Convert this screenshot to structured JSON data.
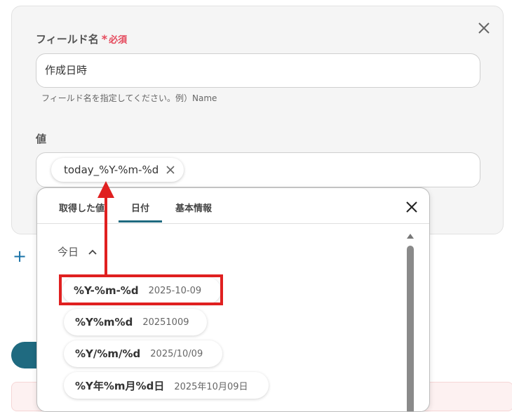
{
  "form": {
    "field_label": "フィールド名",
    "required_star": "*",
    "required_text": "必須",
    "field_value": "作成日時",
    "hint": "フィールド名を指定してください。例）Name",
    "value_label": "値",
    "value_chip": "today_%Y-%m-%d"
  },
  "popup": {
    "tabs": [
      {
        "label": "取得した値"
      },
      {
        "label": "日付"
      },
      {
        "label": "基本情報"
      }
    ],
    "active_tab": "日付",
    "section_label": "今日",
    "options": [
      {
        "format": "%Y-%m-%d",
        "example": "2025-10-09"
      },
      {
        "format": "%Y%m%d",
        "example": "20251009"
      },
      {
        "format": "%Y/%m/%d",
        "example": "2025/10/09"
      },
      {
        "format": "%Y年%m月%d日",
        "example": "2025年10月09日"
      }
    ]
  },
  "colors": {
    "accent": "#1f6a80",
    "required": "#e5485b",
    "annotation": "#e02020"
  },
  "icons": {
    "card_close": "close-icon",
    "chip_remove": "close-icon",
    "popup_close": "close-icon",
    "section_toggle": "chevron-up-icon",
    "add": "plus-icon"
  }
}
